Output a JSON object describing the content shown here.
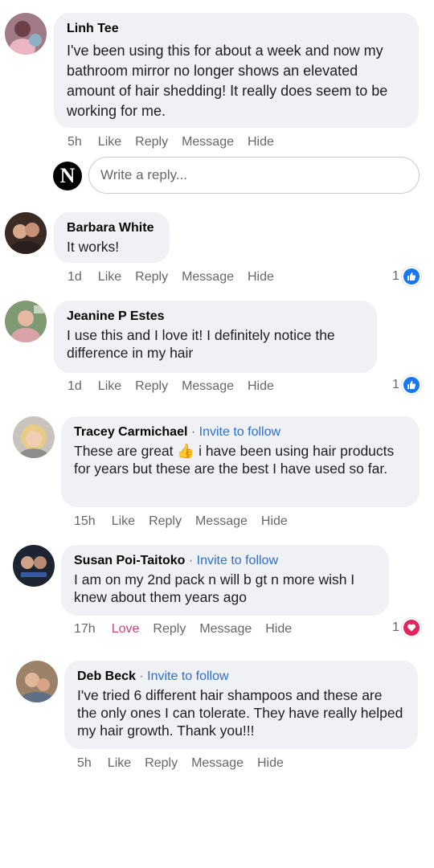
{
  "reply_box": {
    "avatar_letter": "N",
    "placeholder": "Write a reply..."
  },
  "comments": [
    {
      "name": "Linh Tee",
      "invite": "",
      "text": "I've been using this for about a week and now my bathroom mirror no longer shows an elevated amount of hair shedding! It really does seem to be working for me.",
      "time": "5h",
      "like": "Like",
      "reply": "Reply",
      "message": "Message",
      "hide": "Hide",
      "reaction_count": ""
    },
    {
      "name": "Barbara White",
      "invite": "",
      "text": "It works!",
      "time": "1d",
      "like": "Like",
      "reply": "Reply",
      "message": "Message",
      "hide": "Hide",
      "reaction_count": "1",
      "reaction": "like-icon"
    },
    {
      "name": "Jeanine P Estes",
      "invite": "",
      "text": "I use this and I love it! I definitely notice the difference in my hair",
      "time": "1d",
      "like": "Like",
      "reply": "Reply",
      "message": "Message",
      "hide": "Hide",
      "reaction_count": "1",
      "reaction": "like-icon"
    },
    {
      "name": "Tracey Carmichael",
      "separator": "·",
      "invite": "Invite to follow",
      "text_before": "These are great ",
      "emoji": "👍",
      "text_after": " i have been using hair products for years but these are the best I have used so far.",
      "time": "15h",
      "like": "Like",
      "reply": "Reply",
      "message": "Message",
      "hide": "Hide",
      "reaction_count": ""
    },
    {
      "name": "Susan Poi-Taitoko",
      "separator": "·",
      "invite": "Invite to follow",
      "text": "I am on my 2nd pack n will b gt n more wish I knew about them years ago",
      "time": "17h",
      "like": "Love",
      "reply": "Reply",
      "message": "Message",
      "hide": "Hide",
      "reaction_count": "1",
      "reaction": "heart-icon"
    },
    {
      "name": "Deb Beck",
      "separator": "·",
      "invite": "Invite to follow",
      "text": "I've tried 6 different hair shampoos and these are the only ones I can tolerate. They have really helped my hair growth. Thank you!!!",
      "time": "5h",
      "like": "Like",
      "reply": "Reply",
      "message": "Message",
      "hide": "Hide",
      "reaction_count": ""
    }
  ],
  "colors": {
    "link_blue": "#2c6fd1",
    "like_blue": "#1877f2",
    "love_red": "#e0245e",
    "bubble_gray": "#f0f1f5"
  }
}
